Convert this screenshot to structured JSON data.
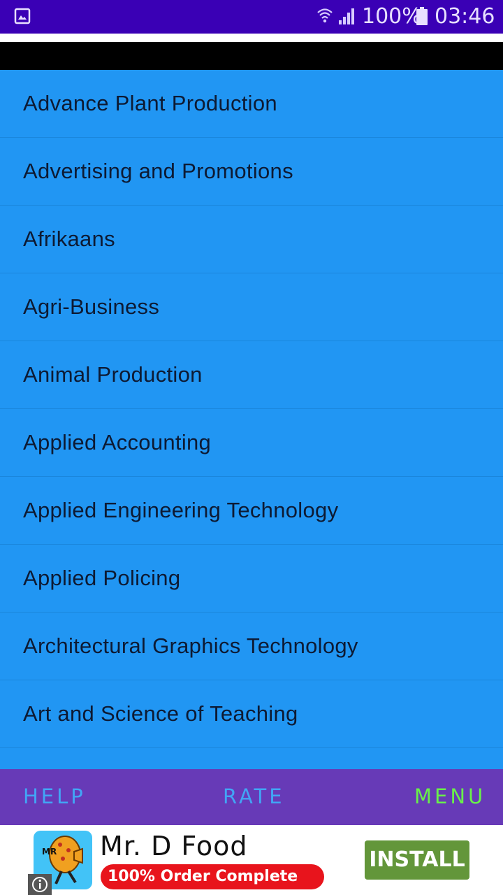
{
  "status_bar": {
    "battery": "100%",
    "time": "03:46",
    "icons": [
      "gallery-icon",
      "wifi-icon",
      "signal-icon",
      "battery-icon"
    ]
  },
  "list": {
    "items": [
      {
        "label": "Advance Plant Production"
      },
      {
        "label": "Advertising and Promotions"
      },
      {
        "label": "Afrikaans"
      },
      {
        "label": "Agri-Business"
      },
      {
        "label": "Animal Production"
      },
      {
        "label": "Applied Accounting"
      },
      {
        "label": "Applied Engineering Technology"
      },
      {
        "label": "Applied Policing"
      },
      {
        "label": "Architectural Graphics Technology"
      },
      {
        "label": "Art and Science of Teaching"
      }
    ]
  },
  "bottom_nav": {
    "help": "HELP",
    "rate": "RATE",
    "menu": "MENU"
  },
  "ad": {
    "logo_text": "MR",
    "title": "Mr. D Food",
    "badge": "100% Order Complete",
    "install": "INSTALL"
  },
  "colors": {
    "status_bar": "#3a00b5",
    "list_bg": "#2196f3",
    "nav_bg": "#673ab7",
    "nav_text": "#42a5f5",
    "menu_text": "#69f04a",
    "badge_red": "#e8141c",
    "install_green": "#63963a"
  }
}
